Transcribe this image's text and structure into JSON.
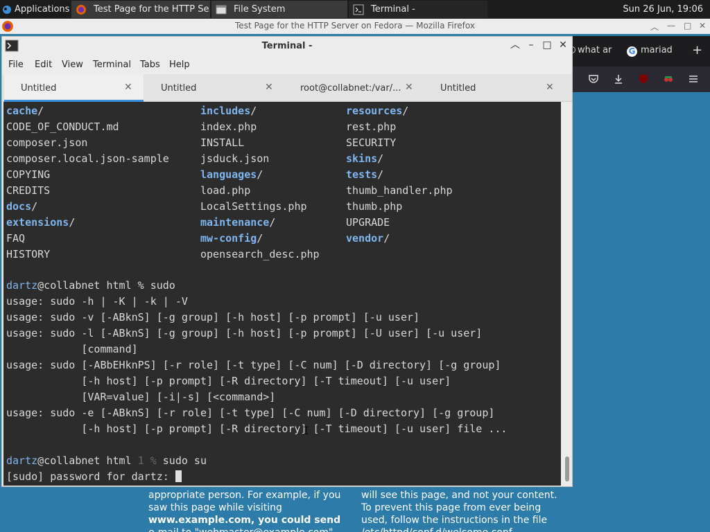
{
  "panel": {
    "applications_label": "Applications",
    "tasks": [
      {
        "label": "Test Page for the HTTP Se..."
      },
      {
        "label": "File System"
      },
      {
        "label": "Terminal -"
      }
    ],
    "clock": "Sun 26 Jun, 19:06"
  },
  "firefox": {
    "title": "Test Page for the HTTP Server on Fedora — Mozilla Firefox",
    "tabs": [
      {
        "label": "what ar"
      },
      {
        "label": "mariad"
      }
    ],
    "new_tab": "+",
    "page_left_lines": [
      "appropriate person. For example, if you",
      "saw this page while visiting",
      "www.example.com, you could send",
      "e-mail to \"webmaster@example.com\""
    ],
    "page_right_lines": [
      "will see this page, and not your content.",
      "To prevent this page from ever being",
      "used, follow the instructions in the file",
      "/etc/httpd/conf.d/welcome.conf"
    ]
  },
  "terminal": {
    "title": "Terminal -",
    "menu": [
      "File",
      "Edit",
      "View",
      "Terminal",
      "Tabs",
      "Help"
    ],
    "tabs": [
      {
        "label": "Untitled"
      },
      {
        "label": "Untitled"
      },
      {
        "label": "root@collabnet:/var/..."
      },
      {
        "label": "Untitled"
      }
    ],
    "listing": {
      "col1": [
        {
          "text": "cache",
          "suffix": "/",
          "dir": true
        },
        {
          "text": "CODE_OF_CONDUCT.md",
          "suffix": "",
          "dir": false
        },
        {
          "text": "composer.json",
          "suffix": "",
          "dir": false
        },
        {
          "text": "composer.local.json-sample",
          "suffix": "",
          "dir": false
        },
        {
          "text": "COPYING",
          "suffix": "",
          "dir": false
        },
        {
          "text": "CREDITS",
          "suffix": "",
          "dir": false
        },
        {
          "text": "docs",
          "suffix": "/",
          "dir": true
        },
        {
          "text": "extensions",
          "suffix": "/",
          "dir": true
        },
        {
          "text": "FAQ",
          "suffix": "",
          "dir": false
        },
        {
          "text": "HISTORY",
          "suffix": "",
          "dir": false
        }
      ],
      "col2": [
        {
          "text": "includes",
          "suffix": "/",
          "dir": true
        },
        {
          "text": "index.php",
          "suffix": "",
          "dir": false
        },
        {
          "text": "INSTALL",
          "suffix": "",
          "dir": false
        },
        {
          "text": "jsduck.json",
          "suffix": "",
          "dir": false
        },
        {
          "text": "languages",
          "suffix": "/",
          "dir": true
        },
        {
          "text": "load.php",
          "suffix": "",
          "dir": false
        },
        {
          "text": "LocalSettings.php",
          "suffix": "",
          "dir": false
        },
        {
          "text": "maintenance",
          "suffix": "/",
          "dir": true
        },
        {
          "text": "mw-config",
          "suffix": "/",
          "dir": true
        },
        {
          "text": "opensearch_desc.php",
          "suffix": "",
          "dir": false
        }
      ],
      "col3": [
        {
          "text": "resources",
          "suffix": "/",
          "dir": true
        },
        {
          "text": "rest.php",
          "suffix": "",
          "dir": false
        },
        {
          "text": "SECURITY",
          "suffix": "",
          "dir": false
        },
        {
          "text": "skins",
          "suffix": "/",
          "dir": true
        },
        {
          "text": "tests",
          "suffix": "/",
          "dir": true
        },
        {
          "text": "thumb_handler.php",
          "suffix": "",
          "dir": false
        },
        {
          "text": "thumb.php",
          "suffix": "",
          "dir": false
        },
        {
          "text": "UPGRADE",
          "suffix": "",
          "dir": false
        },
        {
          "text": "vendor",
          "suffix": "/",
          "dir": true
        },
        {
          "text": "",
          "suffix": "",
          "dir": false
        }
      ]
    },
    "prompt1": {
      "user": "dartz",
      "host": "@collabnet html % ",
      "command": "sudo"
    },
    "usage_lines": [
      "usage: sudo -h | -K | -k | -V",
      "usage: sudo -v [-ABknS] [-g group] [-h host] [-p prompt] [-u user]",
      "usage: sudo -l [-ABknS] [-g group] [-h host] [-p prompt] [-U user] [-u user]",
      "            [command]",
      "usage: sudo [-ABbEHknPS] [-r role] [-t type] [-C num] [-D directory] [-g group]",
      "            [-h host] [-p prompt] [-R directory] [-T timeout] [-u user]",
      "            [VAR=value] [-i|-s] [<command>]",
      "usage: sudo -e [-ABknS] [-r role] [-t type] [-C num] [-D directory] [-g group]",
      "            [-h host] [-p prompt] [-R directory] [-T timeout] [-u user] file ..."
    ],
    "prompt2": {
      "user": "dartz",
      "host": "@collabnet html ",
      "status": "1",
      "sep": " % ",
      "command": "sudo su"
    },
    "password_prompt": "[sudo] password for dartz: "
  }
}
